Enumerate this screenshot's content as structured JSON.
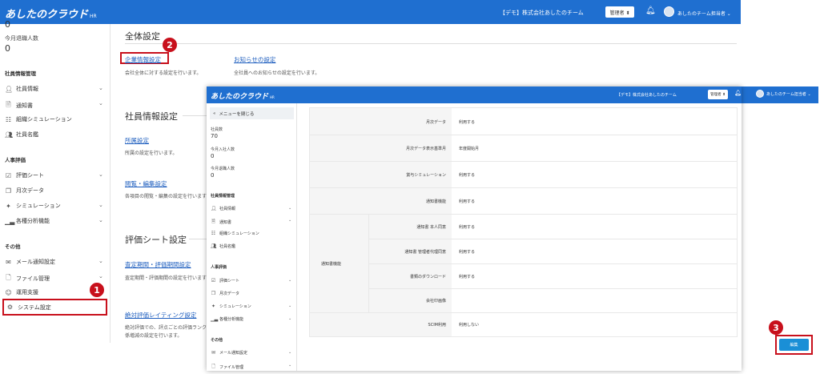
{
  "back": {
    "header": {
      "logo": "あしたのクラウド",
      "logo_suffix": "HR",
      "company": "【デモ】株式会社あしたのチーム",
      "role": "管理者 ⬍",
      "user": "あしたのチーム担当者 ⌄"
    },
    "sidebar": {
      "top_value": "0",
      "retired_label": "今月退職人数",
      "retired_value": "0",
      "sections": {
        "employee": "社員情報管理",
        "eval": "人事評価",
        "other": "その他"
      },
      "items": {
        "info": "社員情報",
        "notice": "通知書",
        "org_sim": "組織シミュレーション",
        "directory": "社員名鑑",
        "eval_sheet": "評価シート",
        "monthly": "月次データ",
        "simulation": "シミュレーション",
        "analysis": "各種分析機能",
        "mail": "メール通知設定",
        "file": "ファイル管理",
        "support": "運用支援",
        "system": "システム設定"
      }
    },
    "main": {
      "general_title": "全体設定",
      "company_link": "企業情報設定",
      "company_desc": "会社全体に対する設定を行います。",
      "notice_link": "お知らせの設定",
      "notice_desc": "全社員へのお知らせの設定を行います。",
      "employee_title": "社員情報設定",
      "affiliation_link": "所属設定",
      "affiliation_desc": "所属の設定を行います。",
      "view_link": "閲覧・編集設定",
      "view_desc": "各項目の閲覧・編集の設定を行います",
      "eval_title": "評価シート設定",
      "period_link": "査定期間・評価期間設定",
      "period_desc": "査定期間・評価期間の設定を行います",
      "absolute_link": "絶対評価レイティング設定",
      "absolute_desc1": "絶対評価での、評点ごとの評価ランク",
      "absolute_desc2": "係増減の設定を行います。"
    }
  },
  "front": {
    "header": {
      "logo": "あしたのクラウド",
      "logo_suffix": "HR",
      "company": "【デモ】株式会社あしたのチーム",
      "role": "管理者 ⬍",
      "user": "あしたのチーム担当者 ⌄"
    },
    "sidebar": {
      "close_menu": "メニューを閉じる",
      "headcount_label": "社員数",
      "headcount_value": "70",
      "joined_label": "今月入社人数",
      "joined_value": "0",
      "retired_label": "今月退職人数",
      "retired_value": "0",
      "sections": {
        "employee": "社員情報管理",
        "eval": "人事評価",
        "other": "その他"
      },
      "items": {
        "info": "社員情報",
        "notice": "通知書",
        "org_sim": "組織シミュレーション",
        "directory": "社員名鑑",
        "eval_sheet": "評価シート",
        "monthly": "月次データ",
        "simulation": "シミュレーション",
        "analysis": "各種分析機能",
        "mail": "メール通知設定",
        "file": "ファイル管理"
      }
    },
    "table": {
      "monthly_label": "月次データ",
      "monthly_value": "利用する",
      "monthly_base_label": "月次データ表示基準月",
      "monthly_base_value": "年度開始月",
      "bonus_label": "賞与シミュレーション",
      "bonus_value": "利用する",
      "notice_func_label": "通知書機能",
      "notice_func_value": "利用する",
      "group_label": "通知書機能",
      "consent_self_label": "通知書 本人同意",
      "consent_self_value": "利用する",
      "consent_proxy_label": "通知書 管理者代理同意",
      "consent_proxy_value": "利用する",
      "download_label": "書類のダウンロード",
      "download_value": "利用する",
      "seal_label": "会社印画像",
      "seal_value": "",
      "scim_label": "SCIM利用",
      "scim_value": "利用しない"
    },
    "edit_button": "編集"
  },
  "badges": {
    "one": "1",
    "two": "2",
    "three": "3"
  }
}
